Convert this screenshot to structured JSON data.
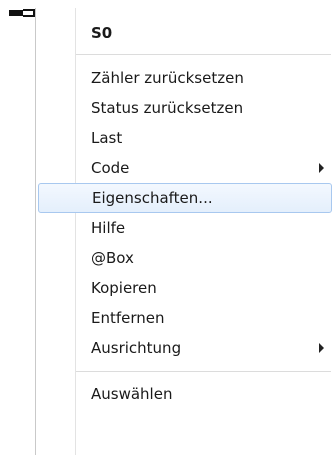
{
  "menu": {
    "header": "S0",
    "items": [
      {
        "label": "Zähler zurücksetzen",
        "submenu": false
      },
      {
        "label": "Status zurücksetzen",
        "submenu": false
      },
      {
        "label": "Last",
        "submenu": false
      },
      {
        "label": "Code",
        "submenu": true
      },
      {
        "label": "Eigenschaften...",
        "submenu": false,
        "highlighted": true
      },
      {
        "label": "Hilfe",
        "submenu": false
      },
      {
        "label": "@Box",
        "submenu": false
      },
      {
        "label": "Kopieren",
        "submenu": false
      },
      {
        "label": "Entfernen",
        "submenu": false
      },
      {
        "label": "Ausrichtung",
        "submenu": true
      }
    ],
    "footer_item": "Auswählen"
  },
  "colors": {
    "highlight_border": "#a8c8ef",
    "highlight_fill": "#e4effc",
    "indicator_green": "#1fd31f"
  }
}
